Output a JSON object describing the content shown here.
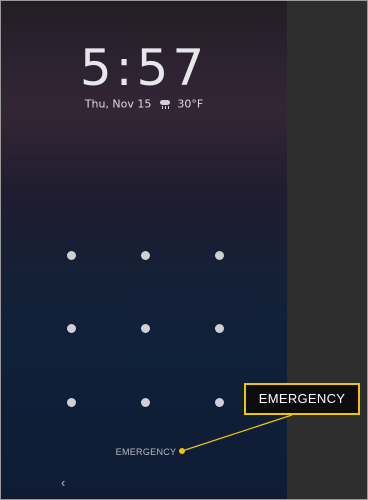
{
  "lock_screen": {
    "time": "5:57",
    "date": "Thu, Nov 15",
    "weather_icon": "rain-cloud-icon",
    "temperature": "30°F",
    "pattern_dots": 9,
    "emergency_label": "EMERGENCY",
    "back_icon": "chevron-left-icon"
  },
  "callout": {
    "label": "EMERGENCY",
    "border_color": "#f2c400"
  },
  "colors": {
    "side_panel": "#2e2e2e",
    "dot": "#cfd0d6",
    "highlight": "#f2c400"
  }
}
